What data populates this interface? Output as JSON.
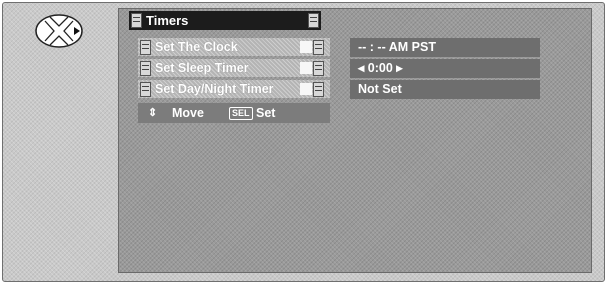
{
  "menu": {
    "title": "Timers",
    "items": [
      {
        "label": "Set The Clock"
      },
      {
        "label": "Set Sleep Timer"
      },
      {
        "label": "Set Day/Night Timer"
      }
    ]
  },
  "help": {
    "move_label": "Move",
    "sel_key": "SEL",
    "set_label": "Set"
  },
  "values": {
    "clock": "-- : --  AM PST",
    "sleep_timer": "◂ 0:00 ▸",
    "day_night_timer": "Not Set"
  },
  "icons": {
    "remote_pad": "dpad-right-icon",
    "help_arrows": "up-down-arrows-icon"
  }
}
